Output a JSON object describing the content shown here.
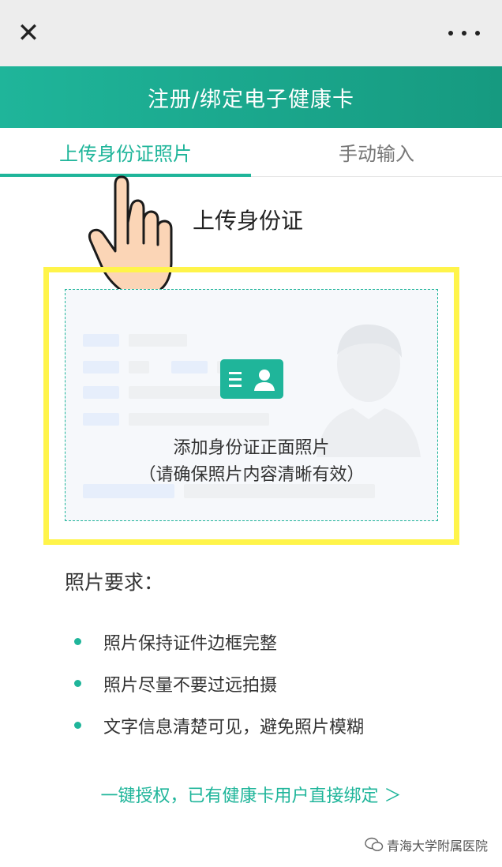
{
  "topbar": {
    "close_glyph": "✕",
    "more_icon": "more-dots-icon"
  },
  "header": {
    "title": "注册/绑定电子健康卡"
  },
  "tabs": [
    {
      "label": "上传身份证照片",
      "active": true
    },
    {
      "label": "手动输入",
      "active": false
    }
  ],
  "upload": {
    "title": "上传身份证",
    "line1": "添加身份证正面照片",
    "line2": "（请确保照片内容清晰有效）"
  },
  "requirements": {
    "title": "照片要求：",
    "items": [
      "照片保持证件边框完整",
      "照片尽量不要过远拍摄",
      "文字信息清楚可见，避免照片模糊"
    ]
  },
  "quick_link": "一键授权，已有健康卡用户直接绑定 ＞",
  "watermark": "青海大学附属医院",
  "colors": {
    "accent": "#1fb59a",
    "highlight": "#fff44a",
    "topbar": "#ededed"
  }
}
